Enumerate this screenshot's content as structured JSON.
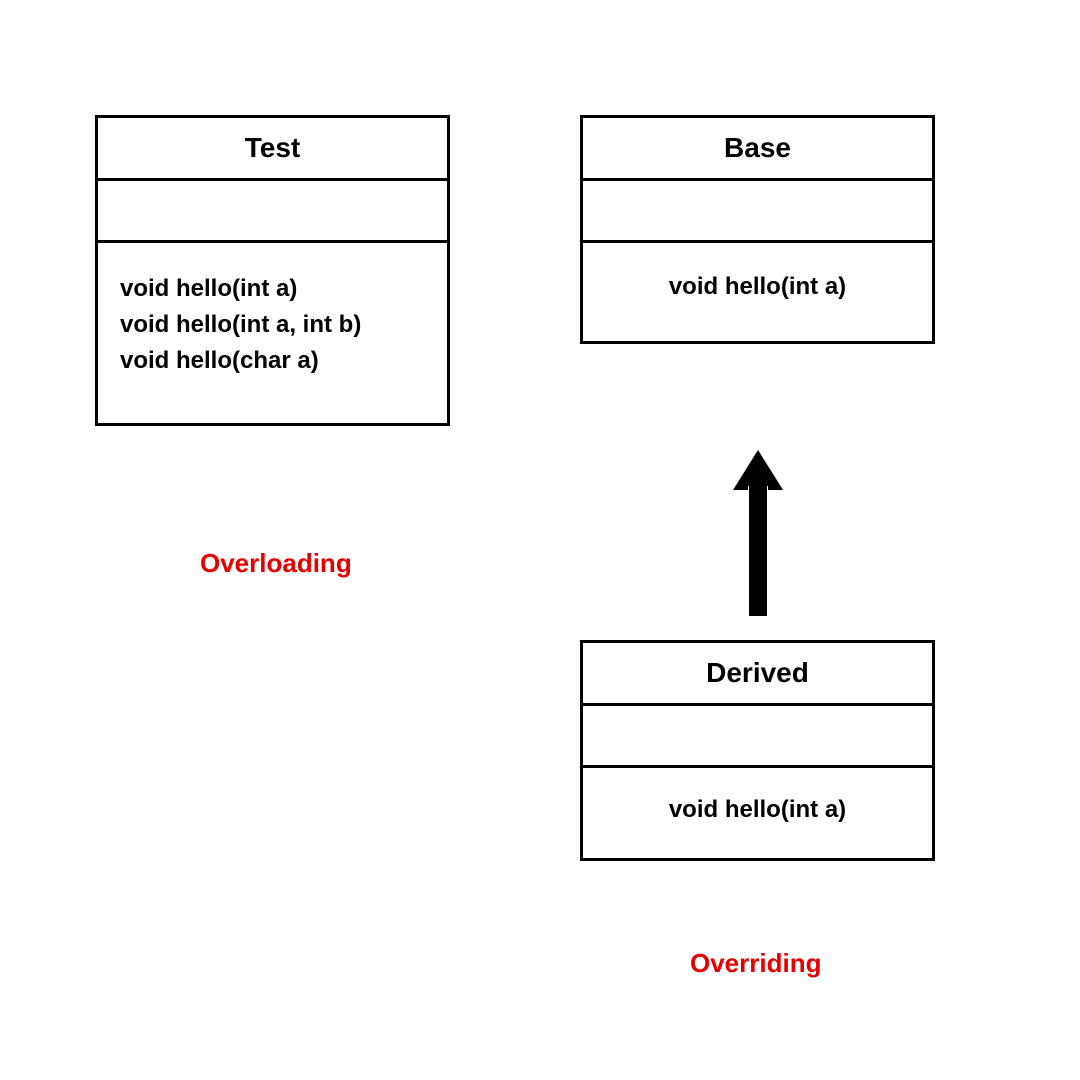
{
  "overloading": {
    "className": "Test",
    "methods": [
      "void hello(int a)",
      "void hello(int a, int b)",
      "void hello(char a)"
    ],
    "caption": "Overloading"
  },
  "overriding": {
    "base": {
      "className": "Base",
      "methods": [
        "void hello(int a)"
      ]
    },
    "derived": {
      "className": "Derived",
      "methods": [
        "void hello(int a)"
      ]
    },
    "caption": "Overriding"
  },
  "colors": {
    "accent": "#e60000",
    "border": "#000000"
  }
}
